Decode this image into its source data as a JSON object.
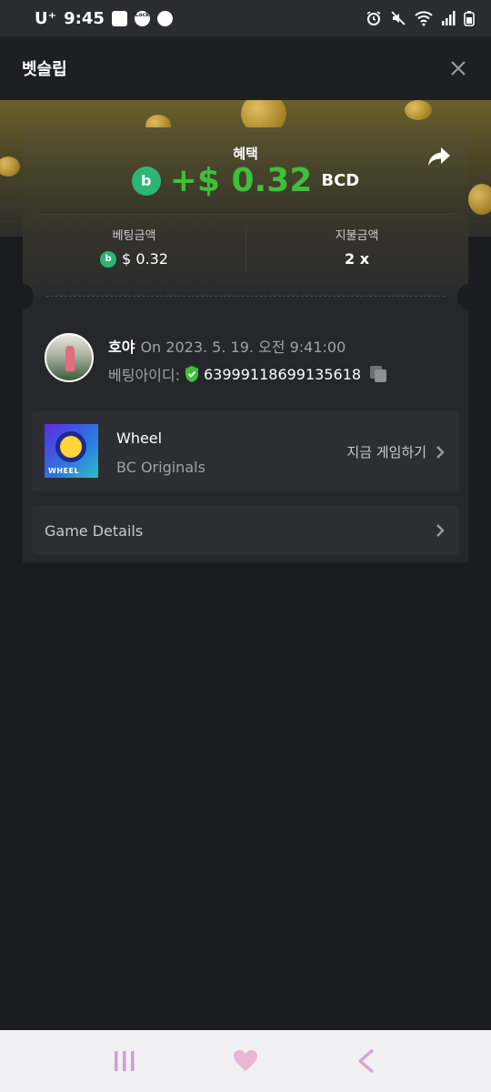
{
  "status_bar": {
    "carrier": "U⁺",
    "time": "9:45",
    "lock_label": "Lock"
  },
  "header": {
    "title": "벳슬립",
    "close_icon": "close-icon"
  },
  "bet": {
    "benefit_label": "혜택",
    "profit_amount": "+$ 0.32",
    "profit_currency": "BCD",
    "coin_icon_letter": "b",
    "bet_amount_label": "베팅금액",
    "bet_amount_value": "$ 0.32",
    "payout_label": "지불금액",
    "payout_value": "2 x"
  },
  "user": {
    "name": "호야",
    "date_text": "On 2023. 5. 19. 오전 9:41:00",
    "bet_id_label": "베팅아이디:",
    "bet_id": "63999118699135618"
  },
  "game": {
    "name": "Wheel",
    "provider": "BC Originals",
    "thumb_label": "WHEEL",
    "play_now": "지금 게임하기"
  },
  "details": {
    "label": "Game Details"
  },
  "colors": {
    "accent_green": "#3cc13b",
    "coin_green": "#2bb673",
    "card_bg": "#26272b",
    "page_bg": "#1b1c1f"
  }
}
